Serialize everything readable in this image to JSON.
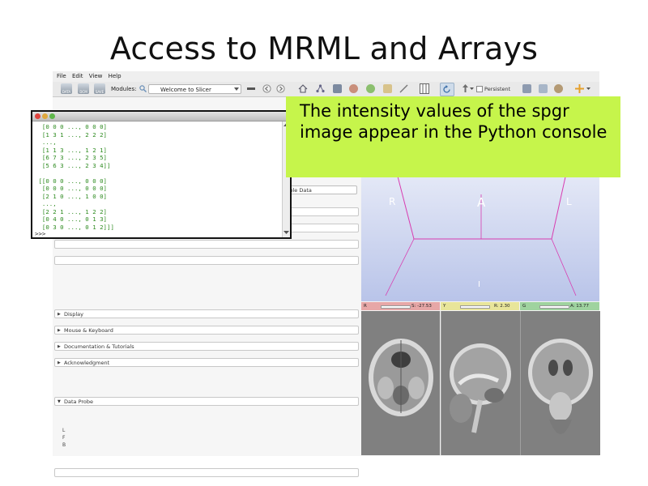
{
  "slide": {
    "title": "Access to MRML and Arrays"
  },
  "menu": {
    "items": [
      "File",
      "Edit",
      "View",
      "Help"
    ]
  },
  "toolbar": {
    "data_label": "DATA",
    "dcm_label": "DCM",
    "save_label": "SAVE",
    "modules_label": "Modules:",
    "module_selected": "Welcome to Slicer",
    "persistent_label": "Persistent"
  },
  "left_panel": {
    "sample_data_button": "mple Data",
    "sections": [
      "Display",
      "Mouse & Keyboard",
      "Documentation & Tutorials",
      "Acknowledgment"
    ],
    "data_probe": "Data Probe",
    "probe_letters": [
      "L",
      "F",
      "B"
    ]
  },
  "view3d": {
    "labels": {
      "left": "R",
      "center": "A",
      "right": "L",
      "bottom": "I"
    }
  },
  "slices": [
    {
      "letter": "R",
      "value": "S: -27.53",
      "color": "#e7a7a7"
    },
    {
      "letter": "Y",
      "value": "R: 2.30",
      "color": "#e8e59a"
    },
    {
      "letter": "G",
      "value": "A: 13.77",
      "color": "#9fd39f"
    }
  ],
  "console": {
    "lines": [
      "  [0 0 0 ..., 0 0 0]",
      "  [1 3 1 ..., 2 2 2]",
      "  ...,",
      "  [1 1 3 ..., 1 2 1]",
      "  [6 7 3 ..., 2 3 5]",
      "  [5 6 3 ..., 2 3 4]]",
      "",
      " [[0 0 0 ..., 0 0 0]",
      "  [0 0 0 ..., 0 0 0]",
      "  [2 1 0 ..., 1 0 0]",
      "  ...,",
      "  [2 2 1 ..., 1 2 2]",
      "  [0 4 0 ..., 0 1 3]",
      "  [0 3 0 ..., 0 1 2]]]"
    ],
    "prompt": ">>>"
  },
  "callout": {
    "text": "The intensity values of the spgr image appear in the Python console"
  },
  "colors": {
    "callout_bg": "#c6f54b",
    "console_text": "#2e8b20",
    "view3d_gradient_bottom": "#b9c4e9"
  }
}
